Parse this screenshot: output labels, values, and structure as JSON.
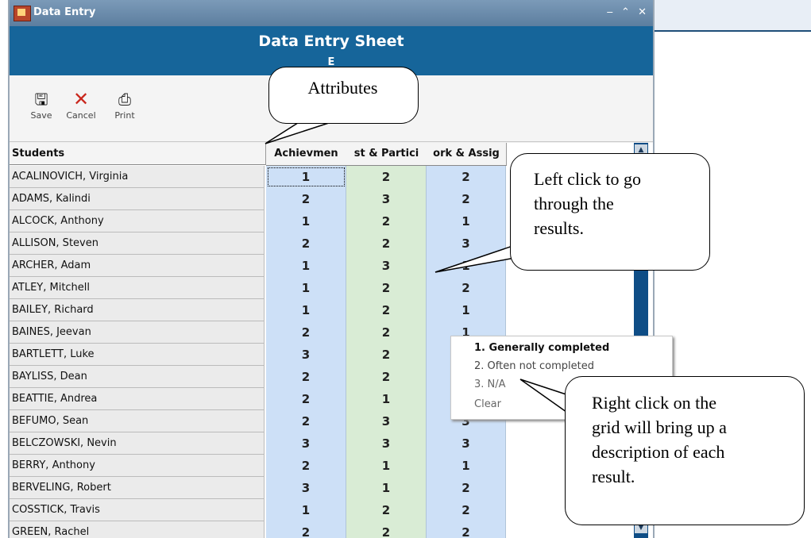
{
  "window": {
    "title": "Data Entry",
    "controls": [
      "‒",
      "⌃",
      "✕"
    ]
  },
  "header": {
    "title": "Data Entry Sheet",
    "subtitle": "E"
  },
  "toolbar": {
    "save_label": "Save",
    "cancel_label": "Cancel",
    "print_label": "Print",
    "save_icon": "floppy-icon",
    "cancel_icon": "x-icon",
    "print_icon": "printer-icon"
  },
  "grid": {
    "columns": [
      "Students",
      "Achievmen",
      "st & Partici",
      "ork & Assig"
    ],
    "rows": [
      {
        "name": "ACALINOVICH, Virginia",
        "a": "1",
        "b": "2",
        "c": "2"
      },
      {
        "name": "ADAMS, Kalindi",
        "a": "2",
        "b": "3",
        "c": "2"
      },
      {
        "name": "ALCOCK, Anthony",
        "a": "1",
        "b": "2",
        "c": "1"
      },
      {
        "name": "ALLISON, Steven",
        "a": "2",
        "b": "2",
        "c": "3"
      },
      {
        "name": "ARCHER, Adam",
        "a": "1",
        "b": "3",
        "c": "1"
      },
      {
        "name": "ATLEY, Mitchell",
        "a": "1",
        "b": "2",
        "c": "2"
      },
      {
        "name": "BAILEY, Richard",
        "a": "1",
        "b": "2",
        "c": "1"
      },
      {
        "name": "BAINES, Jeevan",
        "a": "2",
        "b": "2",
        "c": "1"
      },
      {
        "name": "BARTLETT, Luke",
        "a": "3",
        "b": "2",
        "c": ""
      },
      {
        "name": "BAYLISS, Dean",
        "a": "2",
        "b": "2",
        "c": ""
      },
      {
        "name": "BEATTIE, Andrea",
        "a": "2",
        "b": "1",
        "c": ""
      },
      {
        "name": "BEFUMO, Sean",
        "a": "2",
        "b": "3",
        "c": "3"
      },
      {
        "name": "BELCZOWSKI, Nevin",
        "a": "3",
        "b": "3",
        "c": "3"
      },
      {
        "name": "BERRY, Anthony",
        "a": "2",
        "b": "1",
        "c": "1"
      },
      {
        "name": "BERVELING, Robert",
        "a": "3",
        "b": "1",
        "c": "2"
      },
      {
        "name": "COSSTICK, Travis",
        "a": "1",
        "b": "2",
        "c": "2"
      },
      {
        "name": "GREEN, Rachel",
        "a": "2",
        "b": "2",
        "c": "2"
      }
    ]
  },
  "context_menu": {
    "items": [
      "1. Generally completed",
      "2. Often not completed",
      "3. N/A",
      "Clear"
    ]
  },
  "callouts": {
    "attributes": "Attributes",
    "left_click": [
      "Left click to go",
      "through the",
      "results."
    ],
    "right_click": [
      "Right click on the",
      "grid will bring up a",
      "description of each",
      "result."
    ]
  },
  "colors": {
    "header_blue": "#16659a",
    "col_blue": "#cde0f7",
    "col_green": "#d9ecd5",
    "scroll": "#0e4d86"
  }
}
